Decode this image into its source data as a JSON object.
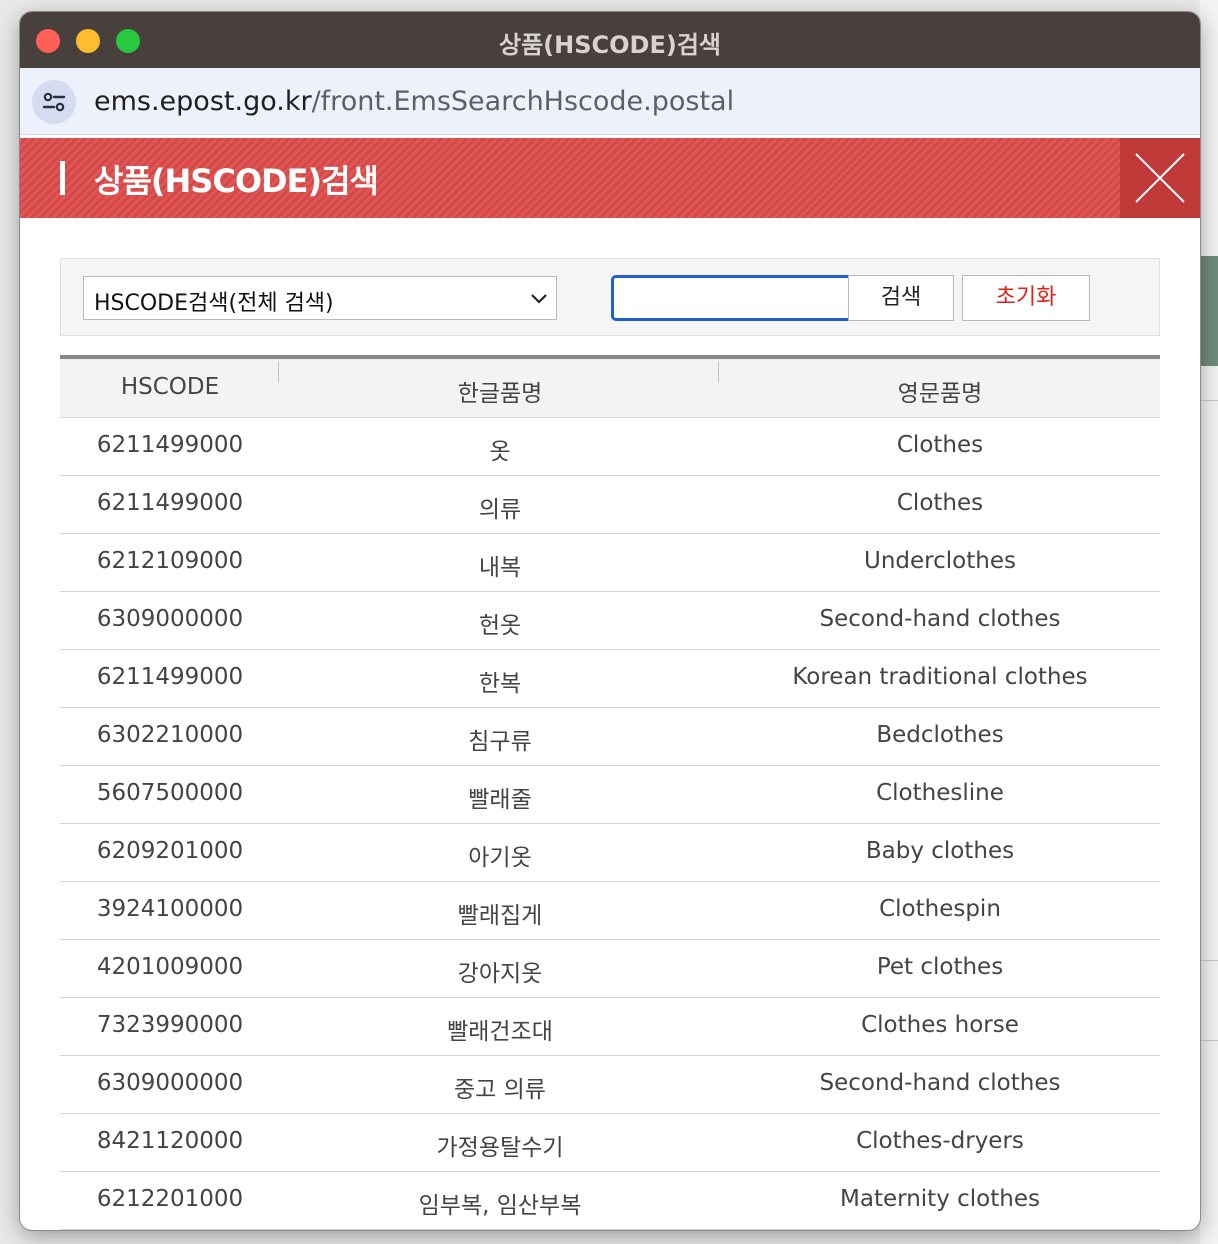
{
  "window": {
    "title": "상품(HSCODE)검색",
    "url_domain": "ems.epost.go.kr",
    "url_path": "/front.EmsSearchHscode.postal"
  },
  "popup": {
    "title": "상품(HSCODE)검색",
    "close_icon": "close-icon"
  },
  "search": {
    "select_value": "HSCODE검색(전체 검색)",
    "input_value": "",
    "search_label": "검색",
    "reset_label": "초기화",
    "reset_color": "#e0221a"
  },
  "table": {
    "headers": [
      "HSCODE",
      "한글품명",
      "영문품명"
    ],
    "rows": [
      {
        "hscode": "6211499000",
        "korean": "옷",
        "english": "Clothes"
      },
      {
        "hscode": "6211499000",
        "korean": "의류",
        "english": "Clothes"
      },
      {
        "hscode": "6212109000",
        "korean": "내복",
        "english": "Underclothes"
      },
      {
        "hscode": "6309000000",
        "korean": "헌옷",
        "english": "Second-hand clothes"
      },
      {
        "hscode": "6211499000",
        "korean": "한복",
        "english": "Korean traditional clothes"
      },
      {
        "hscode": "6302210000",
        "korean": "침구류",
        "english": "Bedclothes"
      },
      {
        "hscode": "5607500000",
        "korean": "빨래줄",
        "english": "Clothesline"
      },
      {
        "hscode": "6209201000",
        "korean": "아기옷",
        "english": "Baby clothes"
      },
      {
        "hscode": "3924100000",
        "korean": "빨래집게",
        "english": "Clothespin"
      },
      {
        "hscode": "4201009000",
        "korean": "강아지옷",
        "english": "Pet clothes"
      },
      {
        "hscode": "7323990000",
        "korean": "빨래건조대",
        "english": "Clothes horse"
      },
      {
        "hscode": "6309000000",
        "korean": "중고 의류",
        "english": "Second-hand clothes"
      },
      {
        "hscode": "8421120000",
        "korean": "가정용탈수기",
        "english": "Clothes-dryers"
      },
      {
        "hscode": "6212201000",
        "korean": "임부복, 임산부복",
        "english": "Maternity clothes"
      }
    ]
  },
  "colors": {
    "header_red": "#e05656",
    "close_red": "#c03a3a",
    "input_border": "#1f5fcf"
  }
}
